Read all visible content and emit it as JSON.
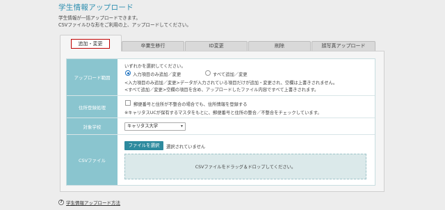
{
  "page": {
    "title": "学生情報アップロード",
    "description": [
      "学生情報が一括アップロードできます。",
      "CSVファイルひな形をご利用の上、アップロードしてください。"
    ]
  },
  "tabs": [
    {
      "label": "追加・変更",
      "active": true
    },
    {
      "label": "卒業生移行",
      "active": false
    },
    {
      "label": "ID変更",
      "active": false
    },
    {
      "label": "削除",
      "active": false
    },
    {
      "label": "顔写真アップロード",
      "active": false
    }
  ],
  "form": {
    "upload_method": {
      "label": "アップロード範囲",
      "prompt": "いずれかを選択してください。",
      "options": [
        {
          "label": "入力項目のみ追加／変更",
          "selected": true
        },
        {
          "label": "すべて追加／変更",
          "selected": false
        }
      ],
      "notes": [
        "<入力項目のみ追加／変更>データが入力されている項目だけが追加・変更され、空欄は上書きされません。",
        "<すべて追加／変更>空欄の項目を含め、アップロードしたファイル内容ですべて上書きされます。"
      ]
    },
    "address_check": {
      "label": "住所登録処理",
      "checkbox_label": "郵便番号と住所が不整合の場合でも、住所情報を登録する",
      "checked": false,
      "note": "※キャリタスUCが保有するマスタをもとに、郵便番号と住所の整合／不整合をチェックしています。"
    },
    "school": {
      "label": "対象学校",
      "selected": "キャリタス大学"
    },
    "csv_file": {
      "label": "CSVファイル",
      "button": "ファイルを選択",
      "status": "選択されていません",
      "dropzone": "CSVファイルをドラッグ＆ドロップしてください。"
    }
  },
  "help": {
    "icon": "question-icon",
    "glyph": "?",
    "label": "学生情報アップロード方法"
  },
  "colors": {
    "title": "#2e8fb0",
    "row_header": "#8ac5cf",
    "button": "#2d8a9e",
    "active_tab_border": "#c00000",
    "dropzone": "#dbe9ea"
  }
}
